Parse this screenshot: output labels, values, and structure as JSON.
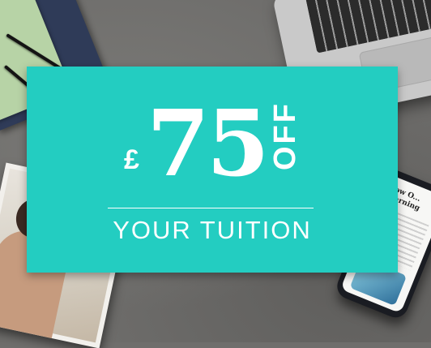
{
  "offer": {
    "currency": "£",
    "amount": "75",
    "off": "OFF",
    "subline": "YOUR TUITION"
  },
  "phone": {
    "heading": "How O... Learning"
  },
  "colors": {
    "voucher": "#23cdc1",
    "text": "#ffffff",
    "desk": "#6e6d6b"
  },
  "icons": [
    "notebook",
    "pen",
    "laptop",
    "photo",
    "smartphone"
  ]
}
